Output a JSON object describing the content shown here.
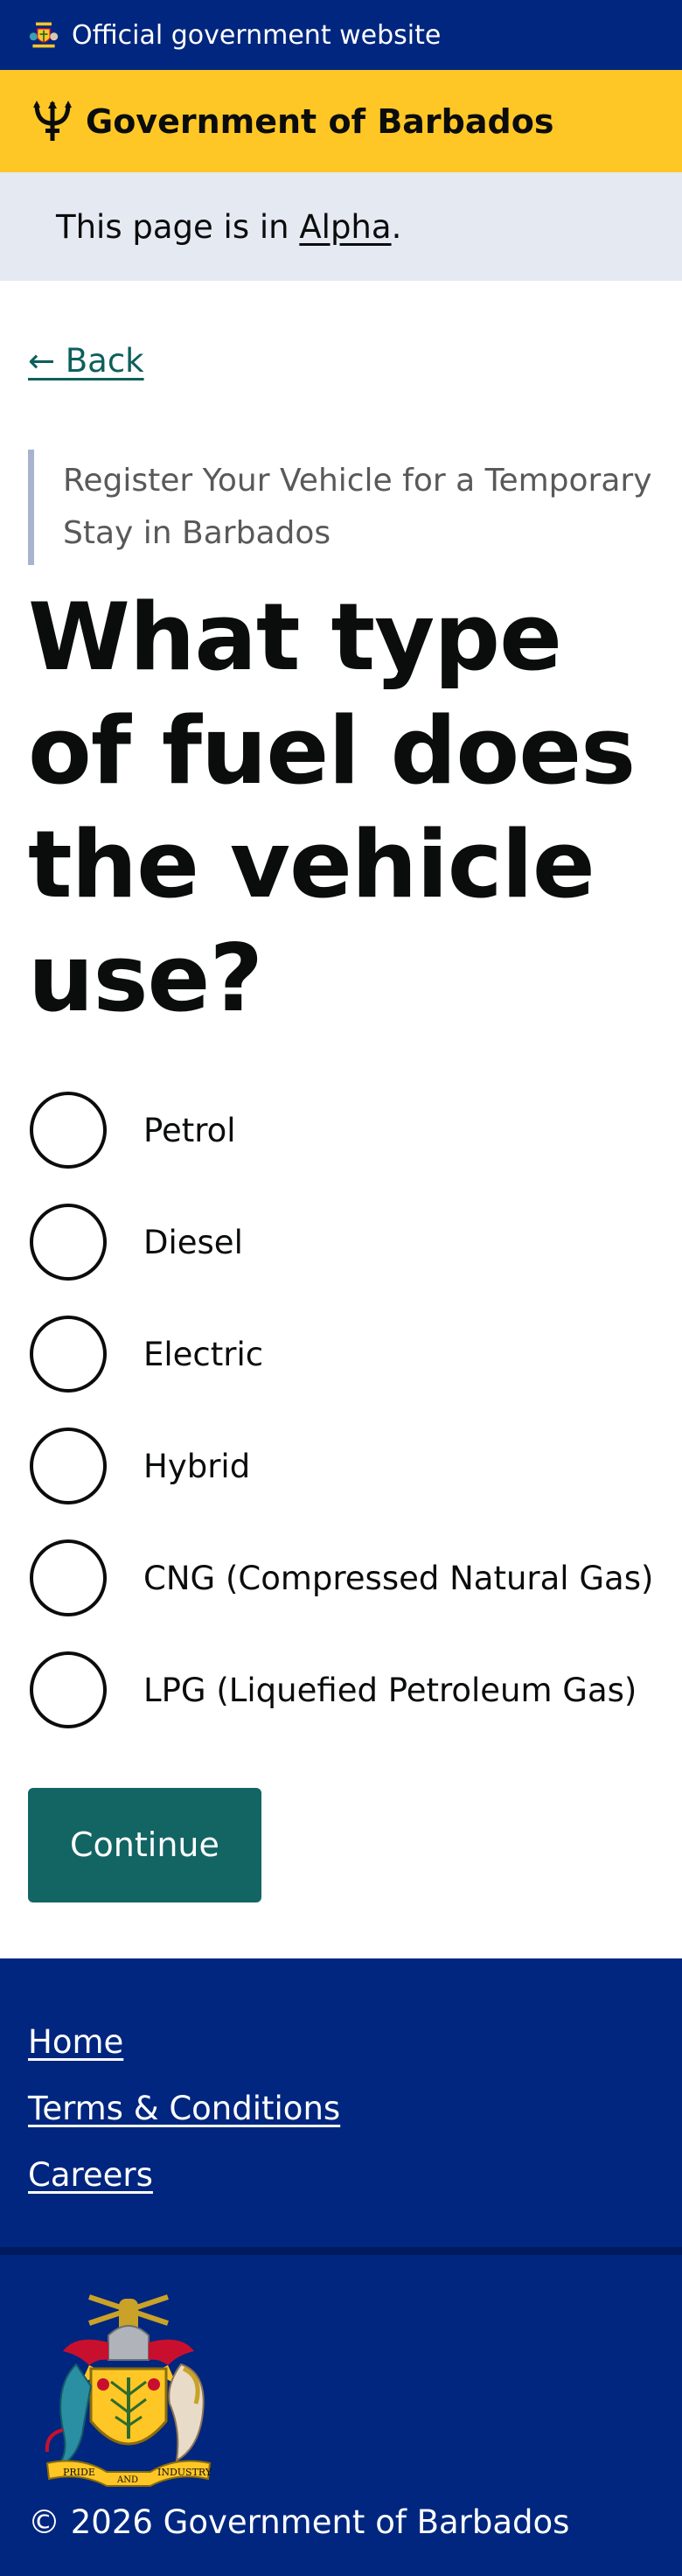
{
  "topbar": {
    "text": "Official government website",
    "crest_icon": "barbados-crest-icon"
  },
  "brand": {
    "name": "Government of Barbados",
    "icon": "trident-icon"
  },
  "phase": {
    "prefix": "This page is in ",
    "link": "Alpha",
    "suffix": "."
  },
  "back": {
    "label": "← Back"
  },
  "caption": "Register Your Vehicle for a Temporary Stay in Barbados",
  "question": "What type of fuel does the vehicle use?",
  "options": [
    {
      "label": "Petrol"
    },
    {
      "label": "Diesel"
    },
    {
      "label": "Electric"
    },
    {
      "label": "Hybrid"
    },
    {
      "label": "CNG (Compressed Natural Gas)"
    },
    {
      "label": "LPG (Liquefied Petroleum Gas)"
    }
  ],
  "continue_label": "Continue",
  "footer": {
    "links": [
      {
        "label": "Home"
      },
      {
        "label": "Terms & Conditions"
      },
      {
        "label": "Careers"
      }
    ],
    "coat_of_arms": {
      "motto_left": "PRIDE",
      "motto_center": "AND",
      "motto_right": "INDUSTRY"
    },
    "copyright": "© 2026 Government of Barbados"
  },
  "colors": {
    "navy": "#00267f",
    "gold": "#ffc726",
    "teal": "#136564",
    "phase_bg": "#e5e9f2"
  }
}
